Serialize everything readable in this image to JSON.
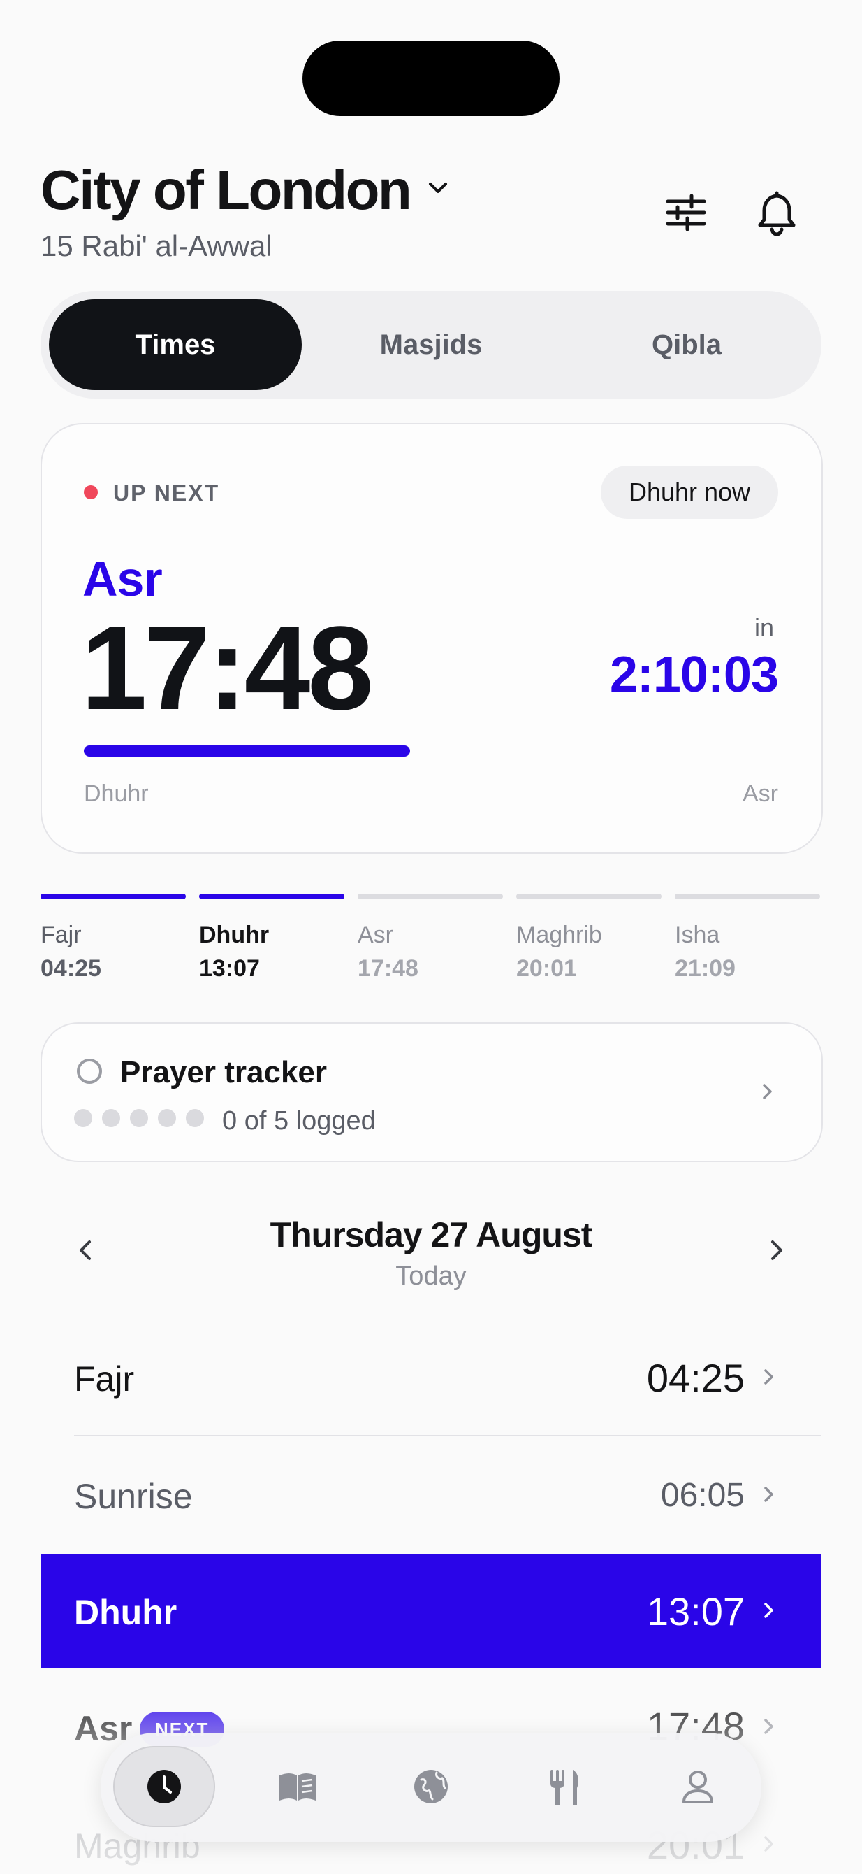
{
  "header": {
    "city": "City of London",
    "hijri_date": "15 Rabi' al-Awwal",
    "icons": [
      "sliders-icon",
      "bell-icon"
    ]
  },
  "segments": [
    {
      "label": "Times",
      "active": true
    },
    {
      "label": "Masjids",
      "active": false
    },
    {
      "label": "Qibla",
      "active": false
    }
  ],
  "next_card": {
    "status_label": "UP NEXT",
    "current_badge": "Dhuhr now",
    "prayer": "Asr",
    "time": "17:48",
    "in_label": "in",
    "countdown": "2:10:03",
    "progress_fraction": 0.47,
    "from": "Dhuhr",
    "to": "Asr"
  },
  "timeline": [
    {
      "name": "Fajr",
      "time": "04:25",
      "state": "past"
    },
    {
      "name": "Dhuhr",
      "time": "13:07",
      "state": "current"
    },
    {
      "name": "Asr",
      "time": "17:48",
      "state": "upcoming"
    },
    {
      "name": "Maghrib",
      "time": "20:01",
      "state": "upcoming"
    },
    {
      "name": "Isha",
      "time": "21:09",
      "state": "upcoming"
    }
  ],
  "tracker": {
    "title": "Prayer tracker",
    "logged_text": "0 of 5 logged",
    "logged": 0,
    "total": 5
  },
  "day": {
    "title": "Thursday 27 August",
    "subtitle": "Today"
  },
  "rows": [
    {
      "name": "Fajr",
      "time": "04:25",
      "badge": ""
    },
    {
      "name": "Sunrise",
      "time": "06:05",
      "badge": ""
    },
    {
      "name": "Dhuhr",
      "time": "13:07",
      "badge": "",
      "highlight": true
    },
    {
      "name": "Asr",
      "time": "17:48",
      "badge": "NEXT"
    },
    {
      "name": "Maghrib",
      "time": "20:01",
      "badge": ""
    }
  ],
  "tabbar": [
    "clock-icon",
    "book-icon",
    "globe-icon",
    "fork-knife-icon",
    "person-icon"
  ],
  "colors": {
    "accent": "#2a05e8",
    "dark": "#111317",
    "alert": "#f0475b"
  }
}
